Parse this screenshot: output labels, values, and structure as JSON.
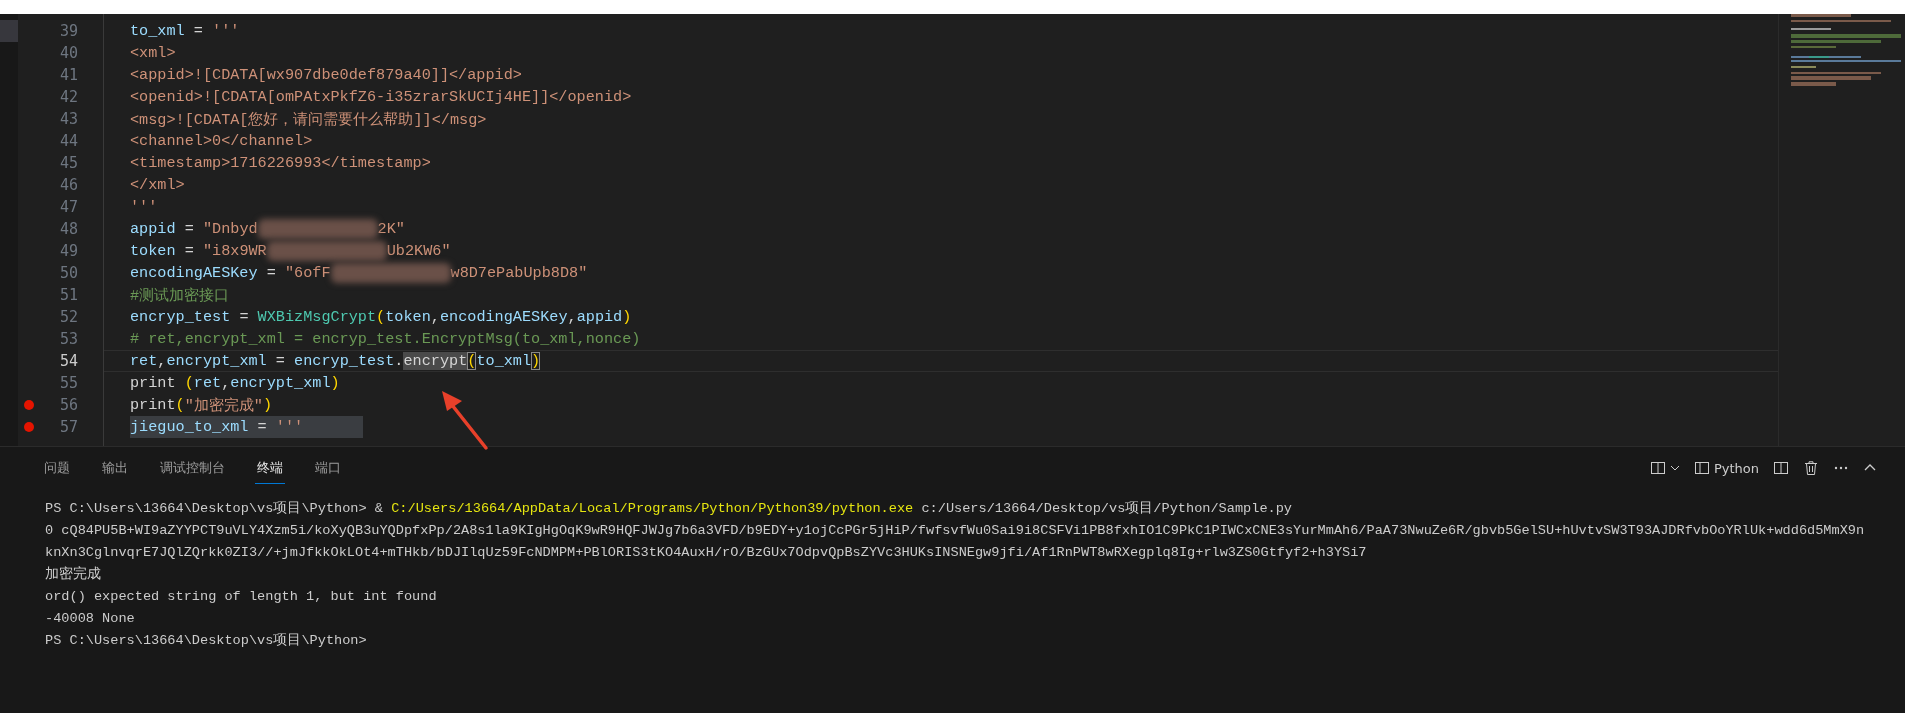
{
  "editor": {
    "lines": [
      {
        "number": "39",
        "kind": "plain",
        "breakpoint": false,
        "tokens": [
          {
            "kind": "var",
            "text": "to_xml"
          },
          {
            "kind": "op",
            "text": " = "
          },
          {
            "kind": "str",
            "text": "'''"
          }
        ]
      },
      {
        "number": "40",
        "kind": "plain",
        "breakpoint": false,
        "tokens": [
          {
            "kind": "str",
            "text": "<xml>"
          }
        ]
      },
      {
        "number": "41",
        "kind": "plain",
        "breakpoint": false,
        "tokens": [
          {
            "kind": "str",
            "text": "<appid>![CDATA[wx907dbe0def879a40]]</appid>"
          }
        ]
      },
      {
        "number": "42",
        "kind": "plain",
        "breakpoint": false,
        "tokens": [
          {
            "kind": "str",
            "text": "<openid>![CDATA[omPAtxPkfZ6-i35zrarSkUCIj4HE]]</openid>"
          }
        ]
      },
      {
        "number": "43",
        "kind": "plain",
        "breakpoint": false,
        "tokens": [
          {
            "kind": "str",
            "text": "<msg>![CDATA[您好，请问需要什么帮助]]</msg>"
          }
        ]
      },
      {
        "number": "44",
        "kind": "plain",
        "breakpoint": false,
        "tokens": [
          {
            "kind": "str",
            "text": "<channel>0</channel>"
          }
        ]
      },
      {
        "number": "45",
        "kind": "plain",
        "breakpoint": false,
        "tokens": [
          {
            "kind": "str",
            "text": "<timestamp>1716226993</timestamp>"
          }
        ]
      },
      {
        "number": "46",
        "kind": "plain",
        "breakpoint": false,
        "tokens": [
          {
            "kind": "str",
            "text": "</xml>"
          }
        ]
      },
      {
        "number": "47",
        "kind": "plain",
        "breakpoint": false,
        "tokens": [
          {
            "kind": "str",
            "text": "'''"
          }
        ]
      },
      {
        "number": "48",
        "kind": "plain",
        "breakpoint": false,
        "tokens": [
          {
            "kind": "var",
            "text": "appid"
          },
          {
            "kind": "op",
            "text": " = "
          },
          {
            "kind": "str",
            "text": "\"Dnbyd"
          },
          {
            "kind": "redacted"
          },
          {
            "kind": "str",
            "text": "2K\""
          }
        ]
      },
      {
        "number": "49",
        "kind": "plain",
        "breakpoint": false,
        "tokens": [
          {
            "kind": "var",
            "text": "token"
          },
          {
            "kind": "op",
            "text": " = "
          },
          {
            "kind": "str",
            "text": "\"i8x9WR"
          },
          {
            "kind": "redacted"
          },
          {
            "kind": "str",
            "text": "Ub2KW6\""
          }
        ]
      },
      {
        "number": "50",
        "kind": "plain",
        "breakpoint": false,
        "tokens": [
          {
            "kind": "var",
            "text": "encodingAESKey"
          },
          {
            "kind": "op",
            "text": " = "
          },
          {
            "kind": "str",
            "text": "\"6ofF"
          },
          {
            "kind": "redacted"
          },
          {
            "kind": "str",
            "text": "w8D7ePabUpb8D8\""
          }
        ]
      },
      {
        "number": "51",
        "kind": "plain",
        "breakpoint": false,
        "tokens": [
          {
            "kind": "comment",
            "text": "#测试加密接口"
          }
        ]
      },
      {
        "number": "52",
        "kind": "plain",
        "breakpoint": false,
        "tokens": [
          {
            "kind": "var",
            "text": "encryp_test"
          },
          {
            "kind": "op",
            "text": " = "
          },
          {
            "kind": "class",
            "text": "WXBizMsgCrypt"
          },
          {
            "kind": "paren",
            "text": "("
          },
          {
            "kind": "var",
            "text": "token"
          },
          {
            "kind": "op",
            "text": ","
          },
          {
            "kind": "var",
            "text": "encodingAESKey"
          },
          {
            "kind": "op",
            "text": ","
          },
          {
            "kind": "var",
            "text": "appid"
          },
          {
            "kind": "paren",
            "text": ")"
          }
        ]
      },
      {
        "number": "53",
        "kind": "plain",
        "breakpoint": false,
        "tokens": [
          {
            "kind": "comment",
            "text": "# ret,encrypt_xml = encryp_test.EncryptMsg(to_xml,nonce)"
          }
        ]
      },
      {
        "number": "54",
        "kind": "current",
        "breakpoint": false,
        "tokens": [
          {
            "kind": "var",
            "text": "ret"
          },
          {
            "kind": "op",
            "text": ","
          },
          {
            "kind": "var",
            "text": "encrypt_xml"
          },
          {
            "kind": "op",
            "text": " = "
          },
          {
            "kind": "var",
            "text": "encryp_test"
          },
          {
            "kind": "op",
            "text": "."
          },
          {
            "kind": "match",
            "text": "encrypt"
          },
          {
            "kind": "bracket",
            "text": "("
          },
          {
            "kind": "var",
            "text": "to_xml"
          },
          {
            "kind": "bracket",
            "text": ")"
          }
        ]
      },
      {
        "number": "55",
        "kind": "plain",
        "breakpoint": false,
        "tokens": [
          {
            "kind": "func",
            "text": "print "
          },
          {
            "kind": "paren",
            "text": "("
          },
          {
            "kind": "var",
            "text": "ret"
          },
          {
            "kind": "op",
            "text": ","
          },
          {
            "kind": "var",
            "text": "encrypt_xml"
          },
          {
            "kind": "paren",
            "text": ")"
          }
        ]
      },
      {
        "number": "56",
        "kind": "plain",
        "breakpoint": true,
        "tokens": [
          {
            "kind": "func",
            "text": "print"
          },
          {
            "kind": "paren",
            "text": "("
          },
          {
            "kind": "str",
            "text": "\"加密完成\""
          },
          {
            "kind": "paren",
            "text": ")"
          }
        ]
      },
      {
        "number": "57",
        "kind": "selected",
        "breakpoint": true,
        "tokens": [
          {
            "kind": "var",
            "text": "jieguo_to_xml"
          },
          {
            "kind": "op",
            "text": " = "
          },
          {
            "kind": "str",
            "text": "'''"
          }
        ]
      }
    ]
  },
  "panel": {
    "tabs": [
      {
        "label": "问题",
        "selected": false
      },
      {
        "label": "输出",
        "selected": false
      },
      {
        "label": "调试控制台",
        "selected": false
      },
      {
        "label": "终端",
        "selected": true
      },
      {
        "label": "端口",
        "selected": false
      }
    ],
    "terminal_name": "Python",
    "output": [
      [
        {
          "kind": "plain",
          "text": "PS C:\\Users\\13664\\Desktop\\vs项目\\Python> & "
        },
        {
          "kind": "path",
          "text": "C:/Users/13664/AppData/Local/Programs/Python/Python39/python.exe"
        },
        {
          "kind": "plain",
          "text": " c:/Users/13664/Desktop/vs项目/Python/Sample.py"
        }
      ],
      [
        {
          "kind": "plain",
          "text": "0 cQ84PU5B+WI9aZYYPCT9uVLY4Xzm5i/koXyQB3uYQDpfxPp/2A8s1la9KIgHgOqK9wR9HQFJWJg7b6a3VFD/b9EDY+y1ojCcPGr5jHiP/fwfsvfWu0Sai9i8CSFVi1PB8fxhIO1C9PkC1PIWCxCNE3sYurMmAh6/PaA73NwuZe6R/gbvb5GelSU+hUvtvSW3T93AJDRfvbOoYRlUk+wdd6d5MmX9n"
        }
      ],
      [
        {
          "kind": "plain",
          "text": "knXn3CglnvqrE7JQlZQrkk0ZI3//+jmJfkkOkLOt4+mTHkb/bDJIlqUz59FcNDMPM+PBlORIS3tKO4AuxH/rO/BzGUx7OdpvQpBsZYVc3HUKsINSNEgw9jfi/Af1RnPWT8wRXegplq8Ig+rlw3ZS0Gtfyf2+h3YSi7"
        }
      ],
      [
        {
          "kind": "plain",
          "text": "加密完成"
        }
      ],
      [
        {
          "kind": "plain",
          "text": "ord() expected string of length 1, but int found"
        }
      ],
      [
        {
          "kind": "plain",
          "text": "-40008 None"
        }
      ],
      [
        {
          "kind": "plain",
          "text": "PS C:\\Users\\13664\\Desktop\\vs项目\\Python>"
        }
      ]
    ]
  }
}
